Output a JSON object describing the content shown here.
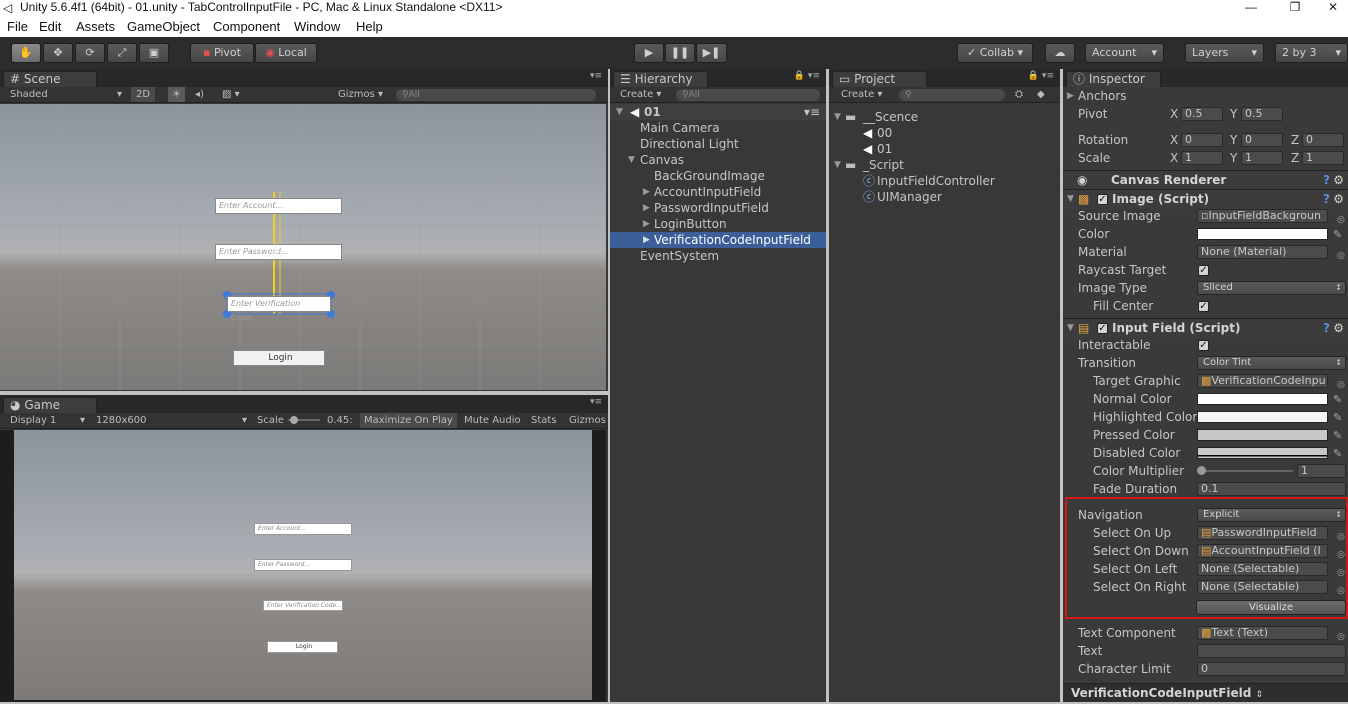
{
  "window": {
    "title": "Unity 5.6.4f1 (64bit) - 01.unity - TabControlInputFile - PC, Mac & Linux Standalone <DX11>",
    "minimize": "—",
    "maximize": "❐",
    "close": "✕"
  },
  "menu": [
    "File",
    "Edit",
    "Assets",
    "GameObject",
    "Component",
    "Window",
    "Help"
  ],
  "toolbar": {
    "tools": [
      "hand-tool",
      "move-tool",
      "rotate-tool",
      "scale-tool",
      "rect-tool"
    ],
    "pivot": "Pivot",
    "local": "Local",
    "collab": "Collab",
    "account": "Account",
    "layers": "Layers",
    "layout": "2 by 3"
  },
  "scene": {
    "tab": "Scene",
    "shading": "Shaded",
    "mode2d": "2D",
    "gizmos": "Gizmos",
    "search": "All",
    "fields": {
      "account": "Enter Account...",
      "password": "Enter Password...",
      "verification": "Enter Verification Code...",
      "login": "Login"
    }
  },
  "game": {
    "tab": "Game",
    "display": "Display 1",
    "resolution": "1280x600",
    "scale_label": "Scale",
    "scale_value": "0.45:",
    "maximize": "Maximize On Play",
    "mute": "Mute Audio",
    "stats": "Stats",
    "gizmos": "Gizmos",
    "fields": {
      "account": "Enter Account...",
      "password": "Enter Password...",
      "verification": "Enter Verification Code...",
      "login": "Login"
    }
  },
  "hierarchy": {
    "tab": "Hierarchy",
    "create": "Create",
    "search": "All",
    "scene_name": "01",
    "items": [
      {
        "label": "Main Camera",
        "depth": 1,
        "arrow": ""
      },
      {
        "label": "Directional Light",
        "depth": 1,
        "arrow": ""
      },
      {
        "label": "Canvas",
        "depth": 1,
        "arrow": "▼"
      },
      {
        "label": "BackGroundImage",
        "depth": 2,
        "arrow": ""
      },
      {
        "label": "AccountInputField",
        "depth": 2,
        "arrow": "▶"
      },
      {
        "label": "PasswordInputField",
        "depth": 2,
        "arrow": "▶"
      },
      {
        "label": "LoginButton",
        "depth": 2,
        "arrow": "▶"
      },
      {
        "label": "VerificationCodeInputField",
        "depth": 2,
        "arrow": "▶",
        "selected": true
      },
      {
        "label": "EventSystem",
        "depth": 1,
        "arrow": ""
      }
    ]
  },
  "project": {
    "tab": "Project",
    "create": "Create",
    "items": [
      {
        "label": "__Scence",
        "depth": 0,
        "type": "folder"
      },
      {
        "label": "00",
        "depth": 1,
        "type": "scene"
      },
      {
        "label": "01",
        "depth": 1,
        "type": "scene"
      },
      {
        "label": "_Script",
        "depth": 0,
        "type": "folder"
      },
      {
        "label": "InputFieldController",
        "depth": 1,
        "type": "script"
      },
      {
        "label": "UIManager",
        "depth": 1,
        "type": "script"
      }
    ]
  },
  "inspector": {
    "tab": "Inspector",
    "anchors": "Anchors",
    "pivot": {
      "label": "Pivot",
      "x": "0.5",
      "y": "0.5"
    },
    "rotation": {
      "label": "Rotation",
      "x": "0",
      "y": "0",
      "z": "0"
    },
    "scale": {
      "label": "Scale",
      "x": "1",
      "y": "1",
      "z": "1"
    },
    "canvas_renderer": "Canvas Renderer",
    "image_script": {
      "title": "Image (Script)",
      "source_image_label": "Source Image",
      "source_image": "InputFieldBackgroun",
      "color_label": "Color",
      "material_label": "Material",
      "material": "None (Material)",
      "raycast_label": "Raycast Target",
      "image_type_label": "Image Type",
      "image_type": "Sliced",
      "fill_center_label": "Fill Center"
    },
    "input_field": {
      "title": "Input Field (Script)",
      "interactable_label": "Interactable",
      "transition_label": "Transition",
      "transition": "Color Tint",
      "target_graphic_label": "Target Graphic",
      "target_graphic": "VerificationCodeInpu",
      "normal_color_label": "Normal Color",
      "highlighted_color_label": "Highlighted Color",
      "pressed_color_label": "Pressed Color",
      "disabled_color_label": "Disabled Color",
      "color_multiplier_label": "Color Multiplier",
      "color_multiplier": "1",
      "fade_duration_label": "Fade Duration",
      "fade_duration": "0.1",
      "navigation_label": "Navigation",
      "navigation": "Explicit",
      "select_up_label": "Select On Up",
      "select_up": "PasswordInputField",
      "select_down_label": "Select On Down",
      "select_down": "AccountInputField (I",
      "select_left_label": "Select On Left",
      "select_left": "None (Selectable)",
      "select_right_label": "Select On Right",
      "select_right": "None (Selectable)",
      "visualize": "Visualize",
      "text_component_label": "Text Component",
      "text_component": "Text (Text)",
      "text_label": "Text",
      "char_limit_label": "Character Limit",
      "char_limit": "0"
    },
    "footer": "VerificationCodeInputField"
  },
  "colors": {
    "selection": "#3d5f99",
    "highlight_box": "#d01a1a",
    "panel_bg": "#383838"
  }
}
